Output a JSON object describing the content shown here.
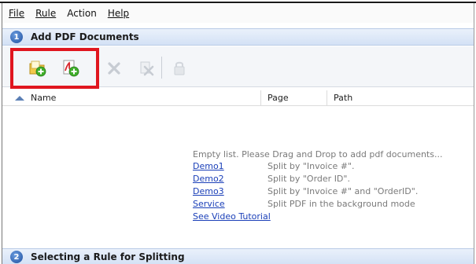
{
  "menu": {
    "items": [
      {
        "label": "File"
      },
      {
        "label": "Rule"
      },
      {
        "label": "Action"
      },
      {
        "label": "Help"
      }
    ]
  },
  "section1": {
    "step": "1",
    "title": "Add PDF Documents"
  },
  "toolbar": {
    "buttons": [
      {
        "icon": "add-folder-icon",
        "enabled": true
      },
      {
        "icon": "add-pdf-icon",
        "enabled": true
      },
      {
        "icon": "remove-icon",
        "enabled": false
      },
      {
        "icon": "remove-all-icon",
        "enabled": false
      },
      {
        "icon": "lock-icon",
        "enabled": false
      }
    ],
    "highlight_color": "#e0161f"
  },
  "columns": {
    "name": "Name",
    "page": "Page",
    "path": "Path"
  },
  "list": {
    "empty_message": "Empty list. Please Drag and Drop to add pdf documents...",
    "demos": [
      {
        "link": "Demo1",
        "desc": "Split by \"Invoice #\"."
      },
      {
        "link": "Demo2",
        "desc": "Split by \"Order ID\"."
      },
      {
        "link": "Demo3",
        "desc": "Split by \"Invoice #\" and \"OrderID\"."
      },
      {
        "link": "Service",
        "desc": "Split PDF in the background mode"
      }
    ],
    "video_link": "See Video Tutorial"
  },
  "section2": {
    "step": "2",
    "title": "Selecting a Rule for Splitting"
  },
  "colors": {
    "header_bg": "#d3e1f5",
    "link": "#1a3fb8",
    "hint_text": "#7a7a7a"
  }
}
